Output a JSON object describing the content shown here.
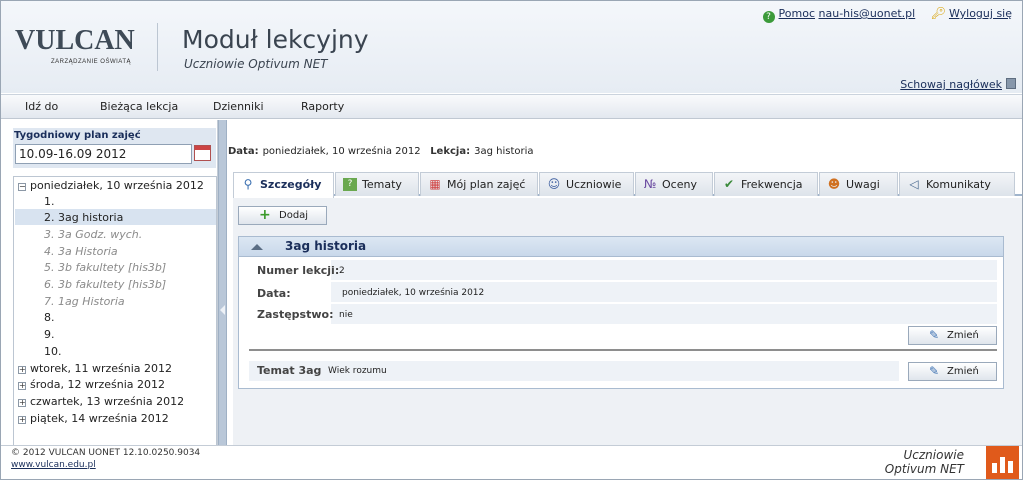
{
  "header": {
    "brand": "VULCAN",
    "brand_sub": "ZARZĄDZANIE OŚWIATĄ",
    "module_title": "Moduł lekcyjny",
    "module_subtitle": "Uczniowie Optivum NET",
    "help_link": "Pomoc",
    "user_email": "nau-his@uonet.pl",
    "logout_link": "Wyloguj się",
    "hide_header_link": "Schowaj nagłówek"
  },
  "menu": {
    "items": [
      "Idź do",
      "Bieżąca lekcja",
      "Dzienniki",
      "Raporty"
    ]
  },
  "sidebar": {
    "week_label": "Tygodniowy plan zajęć",
    "week_value": "10.09-16.09 2012",
    "days": [
      {
        "label": "poniedziałek, 10 września 2012",
        "expanded": true
      },
      {
        "label": "wtorek, 11 września 2012",
        "expanded": false
      },
      {
        "label": "środa, 12 września 2012",
        "expanded": false
      },
      {
        "label": "czwartek, 13 września 2012",
        "expanded": false
      },
      {
        "label": "piątek, 14 września 2012",
        "expanded": false
      }
    ],
    "lessons": [
      {
        "label": "1.",
        "dim": false
      },
      {
        "label": "2. 3ag  historia",
        "dim": false,
        "selected": true
      },
      {
        "label": "3. 3a   Godz. wych.",
        "dim": true
      },
      {
        "label": "4. 3a   Historia",
        "dim": true
      },
      {
        "label": "5. 3b   fakultety [his3b]",
        "dim": true
      },
      {
        "label": "6. 3b   fakultety [his3b]",
        "dim": true
      },
      {
        "label": "7. 1ag  Historia",
        "dim": true
      },
      {
        "label": "8.",
        "dim": false
      },
      {
        "label": "9.",
        "dim": false
      },
      {
        "label": "10.",
        "dim": false
      }
    ],
    "expand_symbols": {
      "minus": "−",
      "plus": "+"
    }
  },
  "lesson_info": {
    "date_label": "Data:",
    "date_value": "poniedziałek, 10 września 2012",
    "lesson_label": "Lekcja:",
    "lesson_value": "3ag  historia"
  },
  "tabs": [
    {
      "label": "Szczegóły",
      "icon": "magnifier-icon",
      "active": true
    },
    {
      "label": "Tematy",
      "icon": "topics-icon"
    },
    {
      "label": "Mój plan zajęć",
      "icon": "plan-grid-icon"
    },
    {
      "label": "Uczniowie",
      "icon": "students-icon"
    },
    {
      "label": "Oceny",
      "icon": "grades-icon"
    },
    {
      "label": "Frekwencja",
      "icon": "attendance-icon"
    },
    {
      "label": "Uwagi",
      "icon": "notes-icon"
    },
    {
      "label": "Komunikaty",
      "icon": "megaphone-icon"
    }
  ],
  "content": {
    "add_button": "Dodaj",
    "panel_title": "3ag  historia",
    "fields": {
      "number_label": "Numer lekcji:",
      "number_value": "2",
      "date_label": "Data:",
      "date_value": "poniedziałek, 10 września 2012",
      "substitute_label": "Zastępstwo:",
      "substitute_value": "nie"
    },
    "change_button": "Zmień",
    "topic_label": "Temat 3ag",
    "topic_value": "Wiek rozumu"
  },
  "footer": {
    "copyright": "© 2012 VULCAN UONET 12.10.0250.9034",
    "site": "www.vulcan.edu.pl",
    "product_line1": "Uczniowie",
    "product_line2": "Optivum NET"
  },
  "colors": {
    "accent_dark": "#1a2e5a",
    "footer_logo": "#e05a1b",
    "tab_border": "#9fb4cc"
  }
}
